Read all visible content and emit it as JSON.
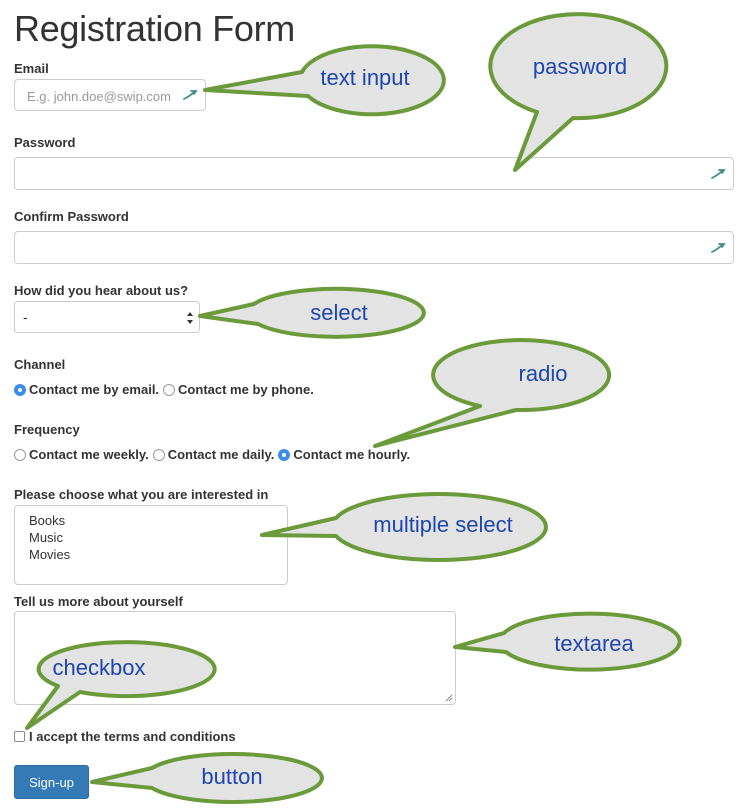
{
  "form": {
    "title": "Registration Form",
    "email": {
      "label": "Email",
      "placeholder": "E.g. john.doe@swip.com"
    },
    "password": {
      "label": "Password",
      "value": ""
    },
    "confirm_password": {
      "label": "Confirm Password",
      "value": ""
    },
    "heard": {
      "label": "How did you hear about us?",
      "selected": "-"
    },
    "channel": {
      "label": "Channel",
      "options": [
        {
          "label": "Contact me by email.",
          "checked": true
        },
        {
          "label": "Contact me by phone.",
          "checked": false
        }
      ]
    },
    "frequency": {
      "label": "Frequency",
      "options": [
        {
          "label": "Contact me weekly.",
          "checked": false
        },
        {
          "label": "Contact me daily.",
          "checked": false
        },
        {
          "label": "Contact me hourly.",
          "checked": true
        }
      ]
    },
    "interests": {
      "label": "Please choose what you are interested in",
      "options": [
        "Books",
        "Music",
        "Movies"
      ]
    },
    "about": {
      "label": "Tell us more about yourself",
      "value": ""
    },
    "terms": {
      "label": "I accept the terms and conditions",
      "checked": false
    },
    "submit": {
      "label": "Sign-up"
    }
  },
  "callouts": {
    "text_input": "text input",
    "password": "password",
    "select": "select",
    "radio": "radio",
    "multiple_select": "multiple select",
    "textarea": "textarea",
    "checkbox": "checkbox",
    "button": "button"
  },
  "colors": {
    "callout_fill": "#e3e3e3",
    "callout_stroke": "#6a9a3a",
    "callout_text": "#1d46b0",
    "primary_button": "#337ab7",
    "radio_checked": "#3b8ee8"
  }
}
